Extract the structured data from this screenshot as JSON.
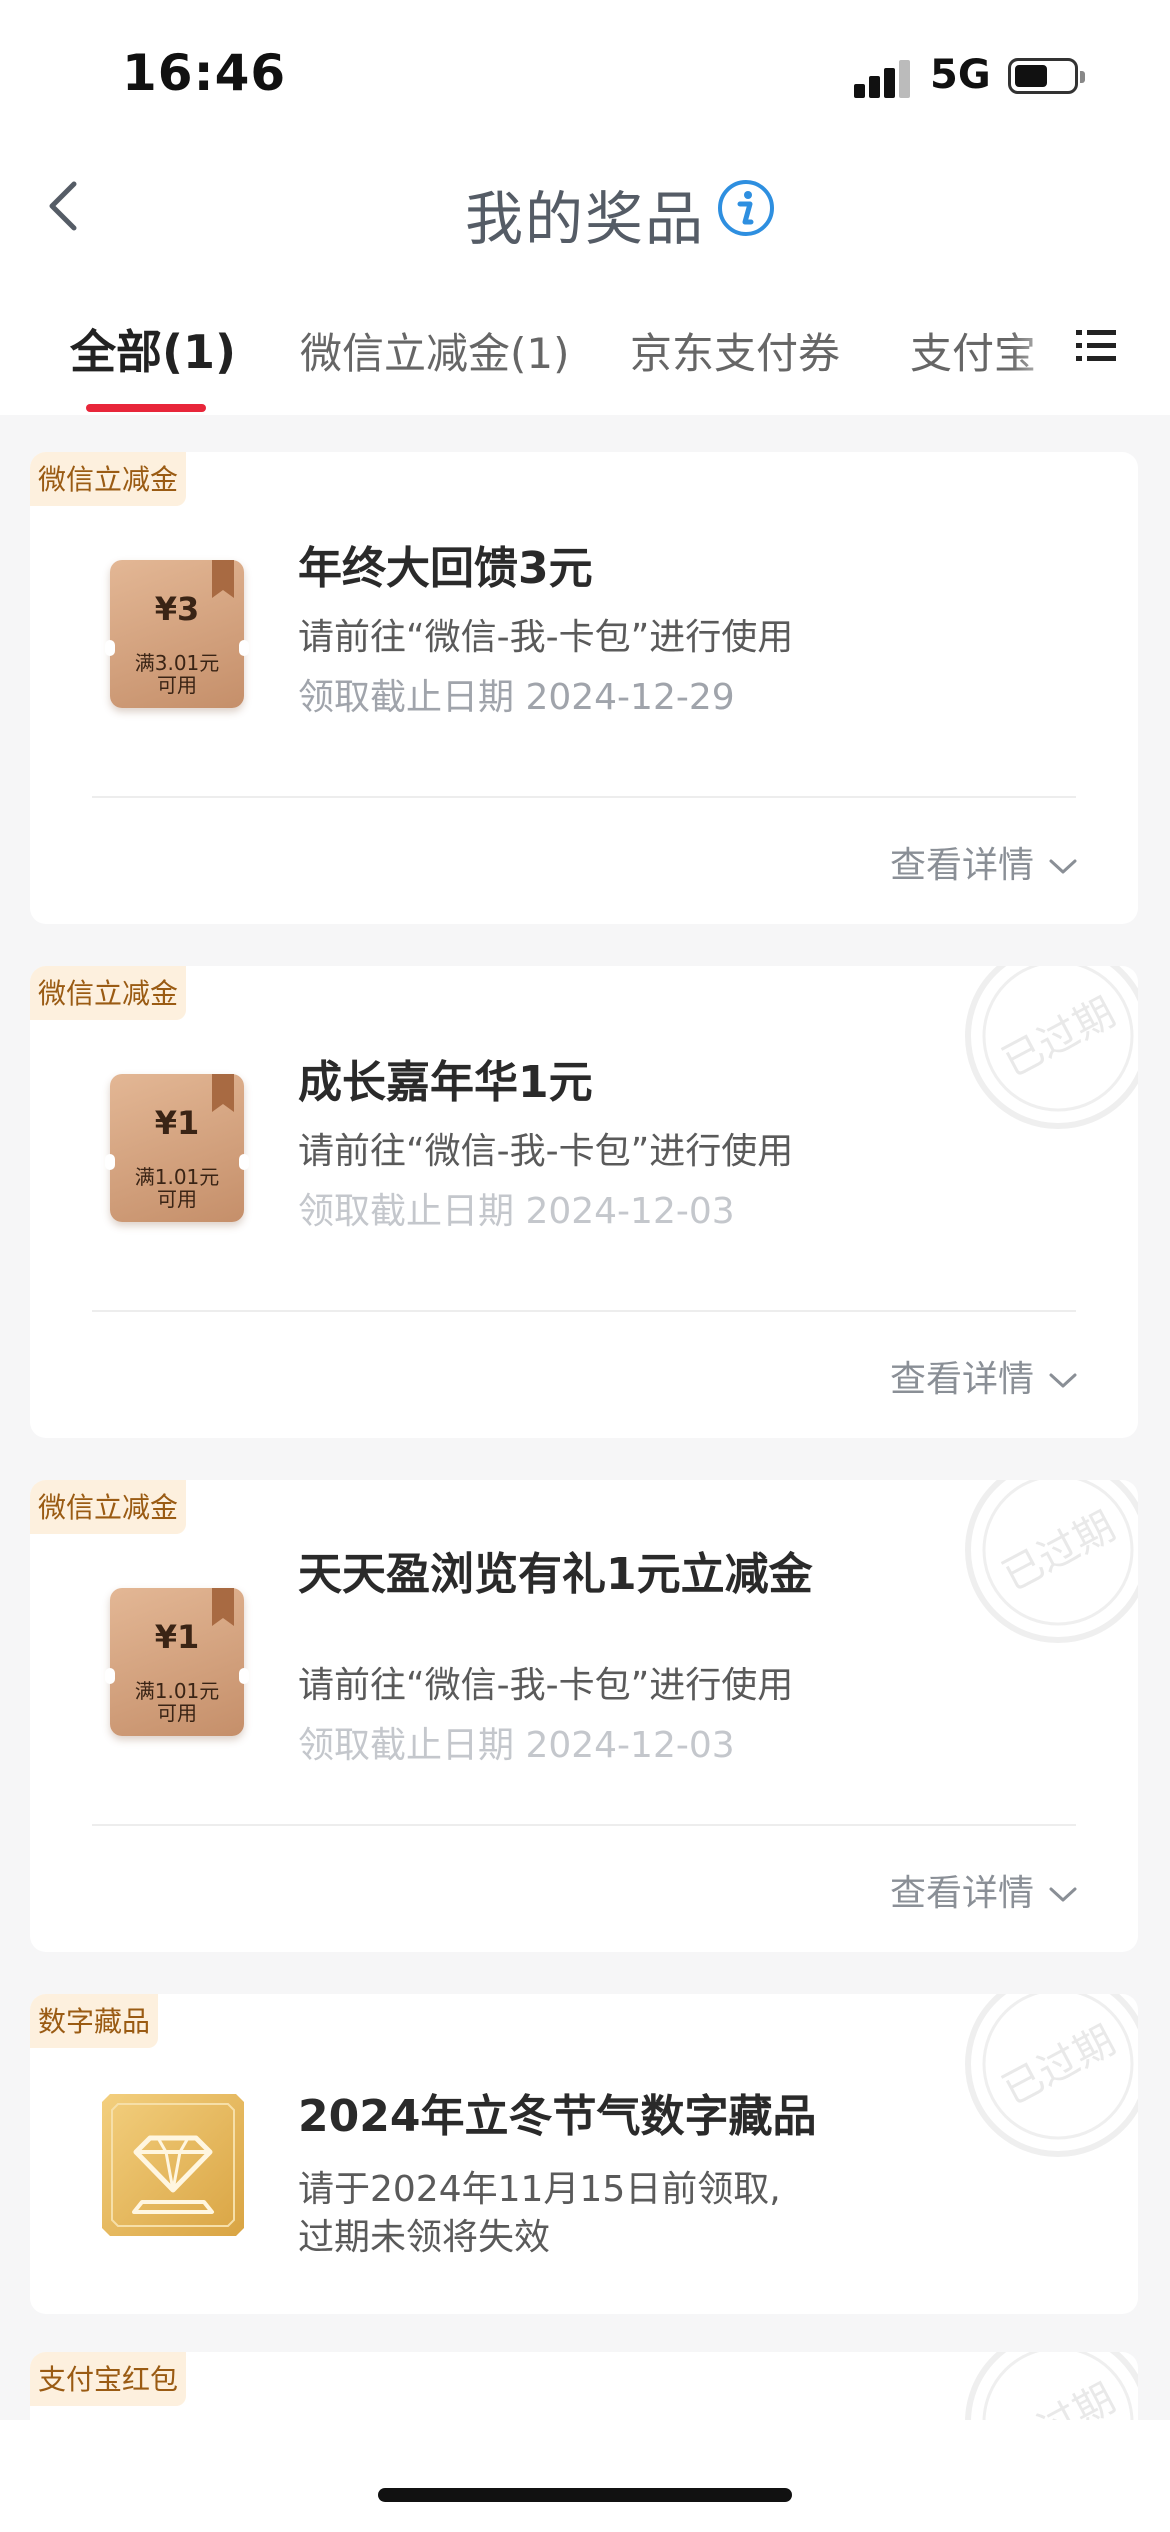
{
  "status_bar": {
    "time": "16:46",
    "network": "5G"
  },
  "header": {
    "title": "我的奖品"
  },
  "tabs": [
    {
      "label": "全部(1)"
    },
    {
      "label": "微信立减金(1)"
    },
    {
      "label": "京东支付券"
    },
    {
      "label": "支付宝"
    }
  ],
  "cards": [
    {
      "tag": "微信立减金",
      "title": "年终大回馈3元",
      "subtitle": "请前往“微信-我-卡包”进行使用",
      "date": "领取截止日期 2024-12-29",
      "coupon_amount": "¥3",
      "coupon_cond_1": "满3.01元",
      "coupon_cond_2": "可用",
      "detail_label": "查看详情",
      "expired": false
    },
    {
      "tag": "微信立减金",
      "title": "成长嘉年华1元",
      "subtitle": "请前往“微信-我-卡包”进行使用",
      "date": "领取截止日期 2024-12-03",
      "coupon_amount": "¥1",
      "coupon_cond_1": "满1.01元",
      "coupon_cond_2": "可用",
      "detail_label": "查看详情",
      "expired": true
    },
    {
      "tag": "微信立减金",
      "title": "天天盈浏览有礼1元立减金",
      "subtitle": "请前往“微信-我-卡包”进行使用",
      "date": "领取截止日期 2024-12-03",
      "coupon_amount": "¥1",
      "coupon_cond_1": "满1.01元",
      "coupon_cond_2": "可用",
      "detail_label": "查看详情",
      "expired": true
    },
    {
      "tag": "数字藏品",
      "title": "2024年立冬节气数字藏品",
      "subtitle_line1": "请于2024年11月15日前领取,",
      "subtitle_line2": "过期未领将失效",
      "expired": true
    },
    {
      "tag": "支付宝红包",
      "expired": true
    }
  ],
  "stamp_text": "已过期",
  "colors": {
    "accent": "#e8263a",
    "tag_bg": "#fdf0de",
    "tag_text": "#9a5b13",
    "info_blue": "#2e8fe0"
  }
}
